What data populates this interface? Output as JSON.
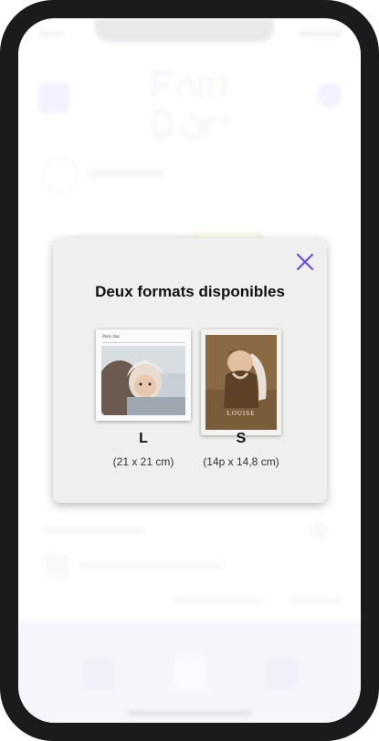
{
  "modal": {
    "title": "Deux formats disponibles",
    "close_icon": "close-icon",
    "accent_color": "#6a4fd3"
  },
  "formats": [
    {
      "letter": "L",
      "dimensions": "(21 x 21 cm)",
      "book_title": "Petit chat"
    },
    {
      "letter": "S",
      "dimensions": "(14p x 14,8 cm)",
      "book_title": "LOUISE"
    }
  ]
}
